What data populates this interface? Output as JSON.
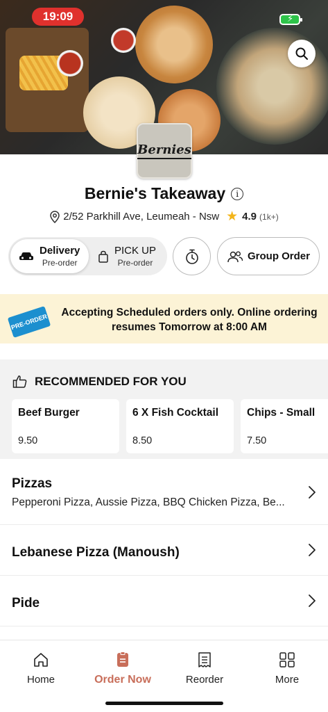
{
  "status_bar": {
    "time": "19:09"
  },
  "store": {
    "logo_text": "Bernies",
    "name": "Bernie's Takeaway",
    "address": "2/52 Parkhill Ave, Leumeah - Nsw",
    "rating": "4.9",
    "rating_count": "(1k+)"
  },
  "order_mode": {
    "delivery": {
      "label": "Delivery",
      "sub": "Pre-order",
      "selected": true
    },
    "pickup": {
      "label": "PICK UP",
      "sub": "Pre-order",
      "selected": false
    },
    "group_order_label": "Group Order"
  },
  "banner": {
    "tag": "PRE-ORDER",
    "message": "Accepting Scheduled orders only. Online ordering resumes Tomorrow at 8:00 AM"
  },
  "recommended": {
    "title": "RECOMMENDED FOR YOU",
    "items": [
      {
        "name": "Beef Burger",
        "price": "9.50"
      },
      {
        "name": "6 X Fish Cocktail",
        "price": "8.50"
      },
      {
        "name": "Chips - Small",
        "price": "7.50"
      }
    ]
  },
  "categories": [
    {
      "name": "Pizzas",
      "description": "Pepperoni Pizza, Aussie Pizza, BBQ Chicken Pizza, Be..."
    },
    {
      "name": "Lebanese Pizza (Manoush)",
      "description": ""
    },
    {
      "name": "Pide",
      "description": ""
    }
  ],
  "bottom_nav": [
    {
      "label": "Home",
      "icon": "home-icon",
      "active": false
    },
    {
      "label": "Order Now",
      "icon": "order-icon",
      "active": true
    },
    {
      "label": "Reorder",
      "icon": "receipt-icon",
      "active": false
    },
    {
      "label": "More",
      "icon": "grid-icon",
      "active": false
    }
  ],
  "colors": {
    "time_pill": "#e0312d",
    "banner_bg": "#fcf3d6",
    "active_nav": "#c86e5a",
    "star": "#f3b51b",
    "preorder_tag": "#1c8fcf"
  }
}
